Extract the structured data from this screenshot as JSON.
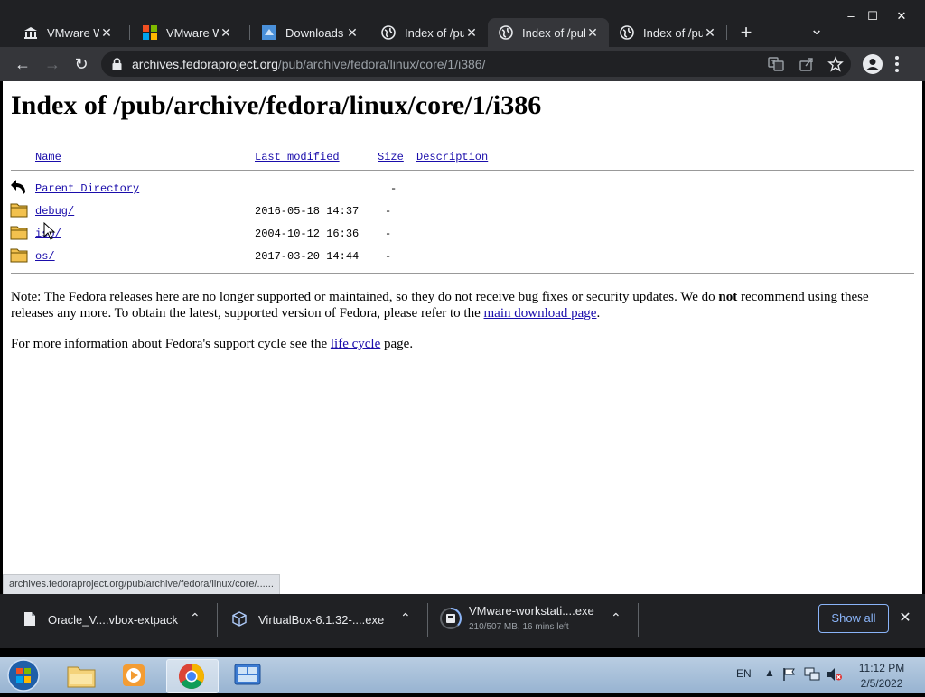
{
  "browser": {
    "tabs": [
      {
        "title": "VMware Wor",
        "icon": "museum-icon",
        "active": false
      },
      {
        "title": "VMware Wor",
        "icon": "microsoft-icon",
        "active": false
      },
      {
        "title": "Downloads -",
        "icon": "downloads-site-icon",
        "active": false
      },
      {
        "title": "Index of /pul",
        "icon": "globe-icon",
        "active": false
      },
      {
        "title": "Index of /pul",
        "icon": "globe-icon",
        "active": true
      },
      {
        "title": "Index of /pul",
        "icon": "globe-icon",
        "active": false
      }
    ],
    "new_tab": "+",
    "tab_list": "⌄",
    "window_controls": {
      "minimize": "–",
      "maximize": "☐",
      "close": "✕"
    },
    "nav": {
      "back": "←",
      "forward": "→",
      "reload": "↻"
    },
    "url_host": "archives.fedoraproject.org",
    "url_path": "/pub/archive/fedora/linux/core/1/i386/"
  },
  "page": {
    "title": "Index of /pub/archive/fedora/linux/core/1/i386",
    "columns": {
      "name": "Name",
      "modified": "Last modified",
      "size": "Size",
      "description": "Description"
    },
    "entries": [
      {
        "name": "Parent Directory",
        "modified": "",
        "size": "-",
        "icon": "back-arrow-icon"
      },
      {
        "name": "debug/",
        "modified": "2016-05-18 14:37",
        "size": "-",
        "icon": "folder-icon"
      },
      {
        "name": "iso/",
        "modified": "2004-10-12 16:36",
        "size": "-",
        "icon": "folder-icon"
      },
      {
        "name": "os/",
        "modified": "2017-03-20 14:44",
        "size": "-",
        "icon": "folder-icon"
      }
    ],
    "note_prefix": "Note: The Fedora releases here are no longer supported or maintained, so they do not receive bug fixes or security updates. We do",
    "note_bold": "not",
    "note_middle": "recommend using these releases any more. To obtain the latest, supported version of Fedora, please refer to the",
    "note_link": "main download page",
    "note_suffix": ".",
    "more_prefix": "For more information about Fedora's support cycle see the",
    "more_link": "life cycle",
    "more_suffix": "page."
  },
  "status_url": "archives.fedoraproject.org/pub/archive/fedora/linux/core/......",
  "downloads": {
    "items": [
      {
        "name": "Oracle_V....vbox-extpack",
        "detail": ""
      },
      {
        "name": "VirtualBox-6.1.32-....exe",
        "detail": ""
      },
      {
        "name": "VMware-workstati....exe",
        "detail": "210/507 MB, 16 mins left"
      }
    ],
    "show_all": "Show all",
    "close": "✕"
  },
  "taskbar": {
    "language": "EN",
    "time": "11:12 PM",
    "date": "2/5/2022"
  },
  "colors": {
    "link": "#1a0dab",
    "chrome_dark": "#202124",
    "chrome_toolbar": "#35363a",
    "accent": "#8ab4f8"
  }
}
